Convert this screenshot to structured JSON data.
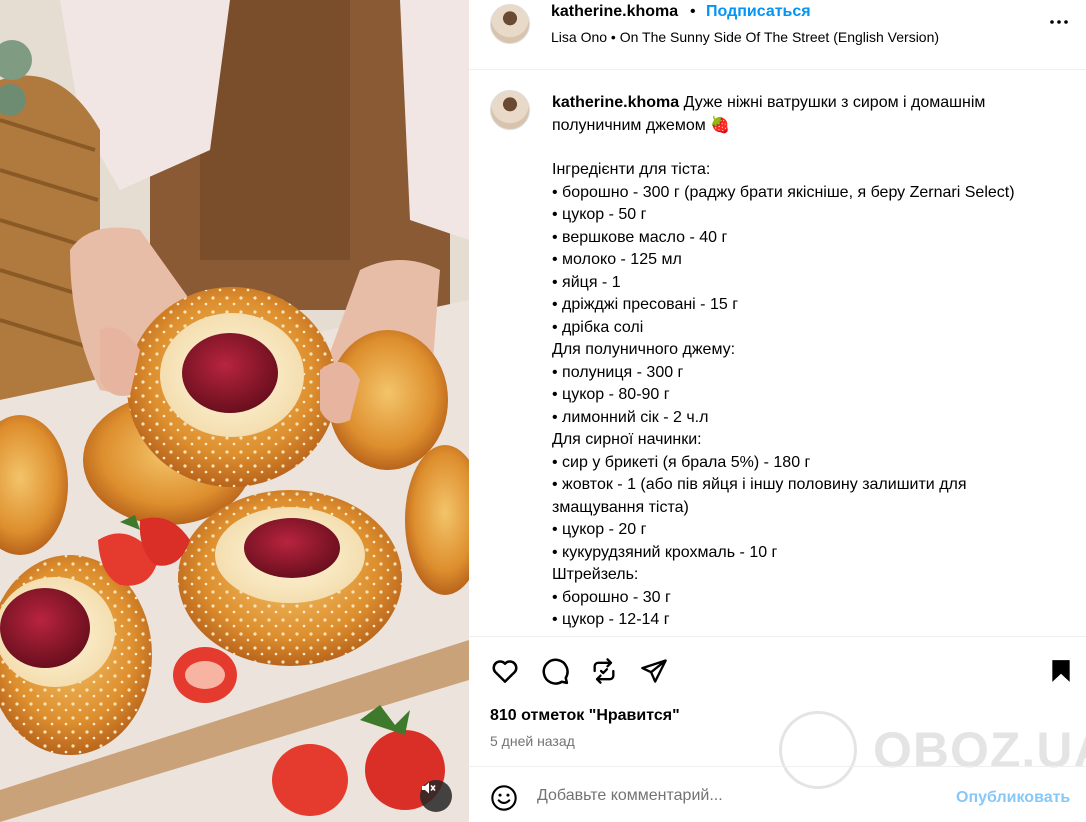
{
  "media": {
    "mute_icon": "speaker-muted-icon"
  },
  "header": {
    "username": "katherine.khoma",
    "dot": "•",
    "follow_label": "Подписаться",
    "music": "Lisa Ono • On The Sunny Side Of The Street (English Version)",
    "more_icon": "more-horizontal-icon"
  },
  "caption": {
    "username": "katherine.khoma",
    "intro_line1": "Дуже ніжні ватрушки з сиром і домашнім",
    "intro_line2": "полуничним джемом 🍓",
    "lines": [
      "Інгредієнти для тіста:",
      "• борошно - 300 г (раджу брати якісніше, я беру Zernari Select)",
      "• цукор - 50 г",
      "• вершкове масло - 40 г",
      "• молоко - 125 мл",
      "• яйця - 1",
      "• дріжджі пресовані - 15 г",
      "• дрібка солі",
      "Для полуничного джему:",
      "• полуниця - 300 г",
      "• цукор - 80-90 г",
      "• лимонний сік - 2 ч.л",
      "Для сирної начинки:",
      "• сир у брикеті (я брала 5%) - 180 г",
      "• жовток - 1 (або пів яйця і іншу половину залишити для",
      "змащування тіста)",
      "• цукор - 20 г",
      "• кукурудзяний крохмаль - 10 г",
      "Штрейзель:",
      "• борошно - 30 г",
      "• цукор - 12-14 г"
    ]
  },
  "actions": {
    "like_icon": "heart-icon",
    "comment_icon": "comment-icon",
    "share_icon": "repost-icon",
    "send_icon": "send-icon",
    "save_icon": "bookmark-icon",
    "likes": "810 отметок \"Нравится\"",
    "date": "5 дней назад"
  },
  "comment": {
    "emoji_icon": "emoji-icon",
    "placeholder": "Добавьте комментарий...",
    "post_label": "Опубликовать"
  },
  "watermark": {
    "text": "OBOZ.UA"
  },
  "colors": {
    "link": "#0095f6",
    "post_disabled": "#87c8f8",
    "muted": "#737373",
    "divider": "#efefef"
  }
}
